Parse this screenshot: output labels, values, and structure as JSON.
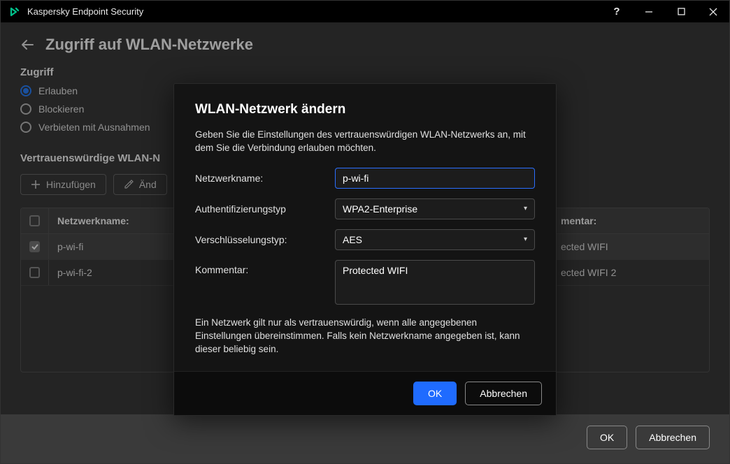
{
  "window": {
    "title": "Kaspersky Endpoint Security"
  },
  "page": {
    "title": "Zugriff auf WLAN-Netzwerke",
    "access_section_label": "Zugriff",
    "radio_options": {
      "allow": "Erlauben",
      "block": "Blockieren",
      "deny_except": "Verbieten mit Ausnahmen"
    },
    "selected_radio": "allow",
    "trusted_heading_truncated": "Vertrauenswürdige WLAN-N",
    "toolbar": {
      "add": "Hinzufügen",
      "edit": "Änd"
    },
    "table": {
      "headers": {
        "name": "Netzwerkname:",
        "comment_truncated": "mentar:"
      },
      "rows": [
        {
          "checked": true,
          "name": "p-wi-fi",
          "comment_truncated": "ected WIFI"
        },
        {
          "checked": false,
          "name": "p-wi-fi-2",
          "comment_truncated": "ected WIFI 2"
        }
      ]
    }
  },
  "footer": {
    "ok": "OK",
    "cancel": "Abbrechen"
  },
  "modal": {
    "title": "WLAN-Netzwerk ändern",
    "description": "Geben Sie die Einstellungen des vertrauenswürdigen WLAN-Netzwerks an, mit dem Sie die Verbindung erlauben möchten.",
    "labels": {
      "name": "Netzwerkname:",
      "auth": "Authentifizierungstyp",
      "enc": "Verschlüsselungstyp:",
      "comment": "Kommentar:"
    },
    "values": {
      "name": "p-wi-fi",
      "auth": "WPA2-Enterprise",
      "enc": "AES",
      "comment": "Protected WIFI"
    },
    "note": "Ein Netzwerk gilt nur als vertrauenswürdig, wenn alle angegebenen Einstellungen übereinstimmen. Falls kein Netzwerkname angegeben ist, kann dieser beliebig sein.",
    "buttons": {
      "ok": "OK",
      "cancel": "Abbrechen"
    }
  }
}
